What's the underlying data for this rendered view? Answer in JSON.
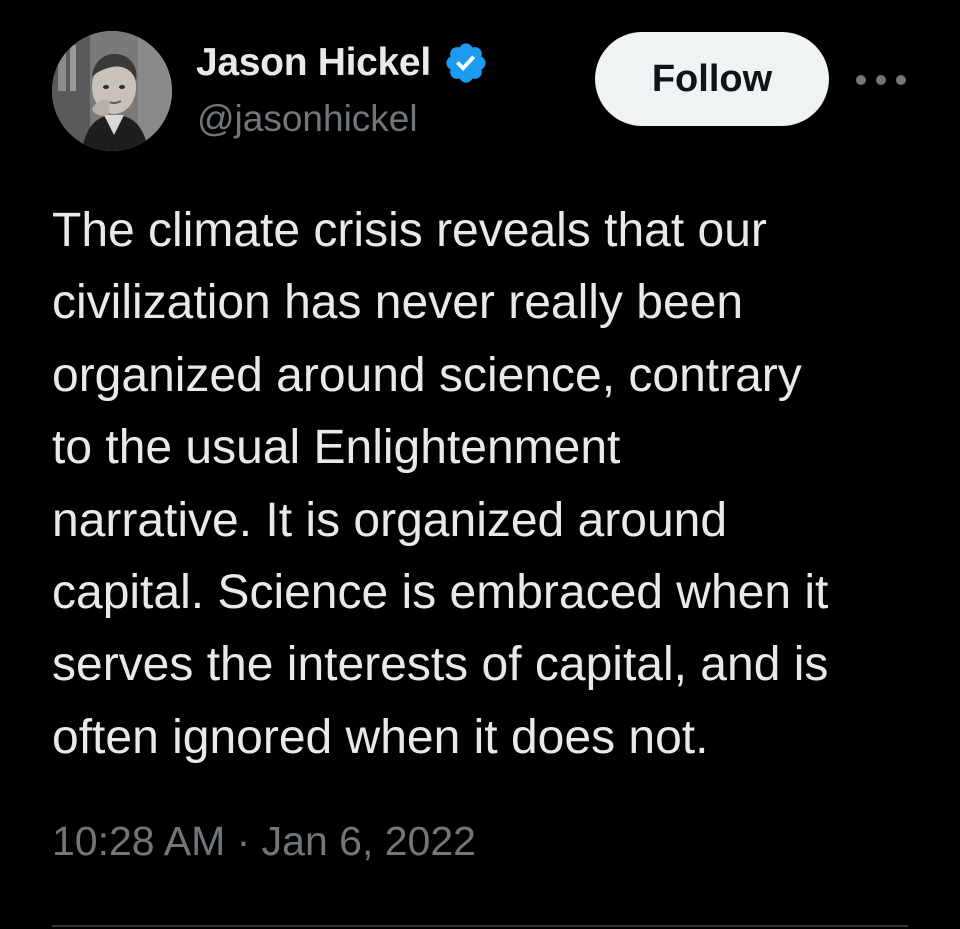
{
  "author": {
    "display_name": "Jason Hickel",
    "handle": "@jasonhickel",
    "verified_icon": "verified-badge-icon",
    "verified_color": "#1d9bf0"
  },
  "actions": {
    "follow_label": "Follow",
    "more_icon": "more-options-icon"
  },
  "tweet": {
    "lines": [
      "The climate crisis reveals that our",
      "civilization has never really been",
      "organized around science, contrary",
      "to the usual Enlightenment",
      "narrative. It is organized around",
      "capital. Science is embraced when it",
      "serves the interests of capital, and is",
      "often ignored when it does not."
    ],
    "timestamp": "10:28 AM · Jan 6, 2022"
  },
  "colors": {
    "background": "#000000",
    "text_primary": "#e7e9ea",
    "text_secondary": "#71767b",
    "follow_button_bg": "#eff3f4",
    "divider": "#2f3336"
  }
}
